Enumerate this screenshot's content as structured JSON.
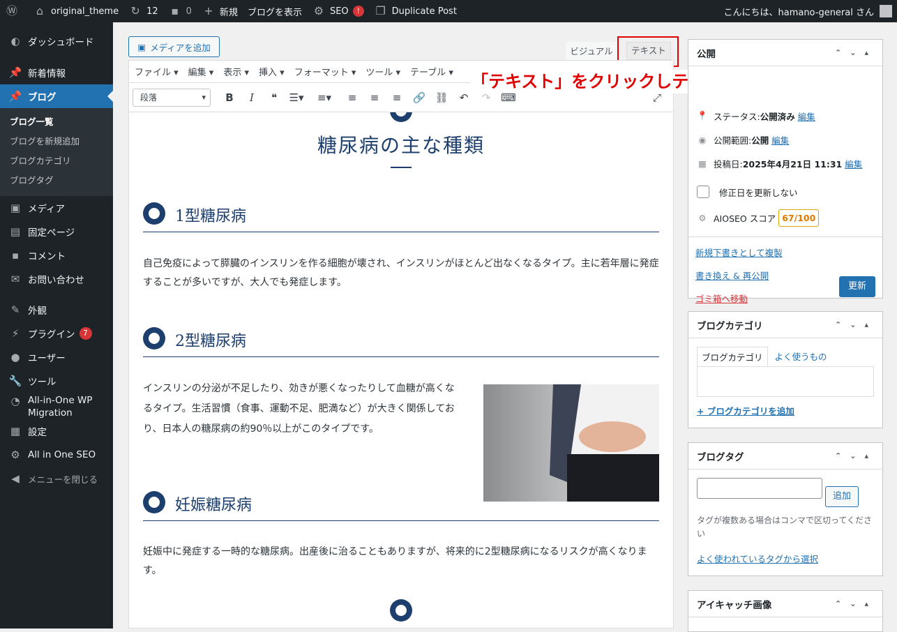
{
  "adminbar": {
    "wp_icon": "wordpress-icon",
    "site_name": "original_theme",
    "updates_count": "12",
    "comments_count": "0",
    "new_label": "新規",
    "view_blog_label": "ブログを表示",
    "seo_label": "SEO",
    "seo_badge": "!",
    "duplicate_post_label": "Duplicate Post",
    "greeting": "こんにちは、hamano-general さん"
  },
  "sidebar": {
    "items": [
      {
        "label": "ダッシュボード",
        "icon": "dashboard-icon"
      },
      {
        "label": "新着情報",
        "icon": "pin-icon"
      },
      {
        "label": "ブログ",
        "icon": "pin-icon"
      },
      {
        "label": "メディア",
        "icon": "media-icon"
      },
      {
        "label": "固定ページ",
        "icon": "page-icon"
      },
      {
        "label": "コメント",
        "icon": "comment-icon"
      },
      {
        "label": "お問い合わせ",
        "icon": "mail-icon"
      },
      {
        "label": "外観",
        "icon": "brush-icon"
      },
      {
        "label": "プラグイン",
        "icon": "plugin-icon",
        "badge": "7"
      },
      {
        "label": "ユーザー",
        "icon": "user-icon"
      },
      {
        "label": "ツール",
        "icon": "wrench-icon"
      },
      {
        "label": "All-in-One WP Migration",
        "icon": "migration-icon"
      },
      {
        "label": "設定",
        "icon": "settings-icon"
      },
      {
        "label": "All in One SEO",
        "icon": "seo-icon"
      },
      {
        "label": "メニューを閉じる",
        "icon": "collapse-icon"
      }
    ],
    "submenu": [
      "ブログ一覧",
      "ブログを新規追加",
      "ブログカテゴリ",
      "ブログタグ"
    ]
  },
  "editor": {
    "add_media": "メディアを追加",
    "tab_visual": "ビジュアル",
    "tab_text": "テキスト",
    "annotation": "「テキスト」をクリックしテキストモードへ切り替え",
    "menus": [
      "ファイル ▾",
      "編集 ▾",
      "表示 ▾",
      "挿入 ▾",
      "フォーマット ▾",
      "ツール ▾",
      "テーブル ▾"
    ],
    "format_select": "段落",
    "content": {
      "heading": "糖尿病の主な種類",
      "section1_title": "1型糖尿病",
      "section1_text": "自己免疫によって膵臓のインスリンを作る細胞が壊され、インスリンがほとんど出なくなるタイプ。主に若年層に発症することが多いですが、大人でも発症します。",
      "section2_title": "2型糖尿病",
      "section2_text": "インスリンの分泌が不足したり、効きが悪くなったりして血糖が高くなるタイプ。生活習慣（食事、運動不足、肥満など）が大きく関係しており、日本人の糖尿病の約90％以上がこのタイプです。",
      "section3_title": "妊娠糖尿病",
      "section3_text": "妊娠中に発症する一時的な糖尿病。出産後に治ることもありますが、将来的に2型糖尿病になるリスクが高くなります。"
    }
  },
  "publish": {
    "title": "公開",
    "status_label": "ステータス: ",
    "status_value": "公開済み",
    "visibility_label": "公開範囲: ",
    "visibility_value": "公開",
    "date_label": "投稿日: ",
    "date_value": "2025年4月21日 11:31",
    "edit": "編集",
    "no_update_date": "修正日を更新しない",
    "aioseo_label": "AIOSEO スコア",
    "aioseo_score": "67/100",
    "copy_new_draft": "新規下書きとして複製",
    "rewrite_republish": "書き換え & 再公開",
    "trash": "ゴミ箱へ移動",
    "update": "更新"
  },
  "category_box": {
    "title": "ブログカテゴリ",
    "tab_all": "ブログカテゴリ",
    "tab_popular": "よく使うもの",
    "add_link": "+ ブログカテゴリを追加"
  },
  "tag_box": {
    "title": "ブログタグ",
    "add_button": "追加",
    "hint": "タグが複数ある場合はコンマで区切ってください",
    "choose_link": "よく使われているタグから選択"
  },
  "featured_box": {
    "title": "アイキャッチ画像"
  }
}
